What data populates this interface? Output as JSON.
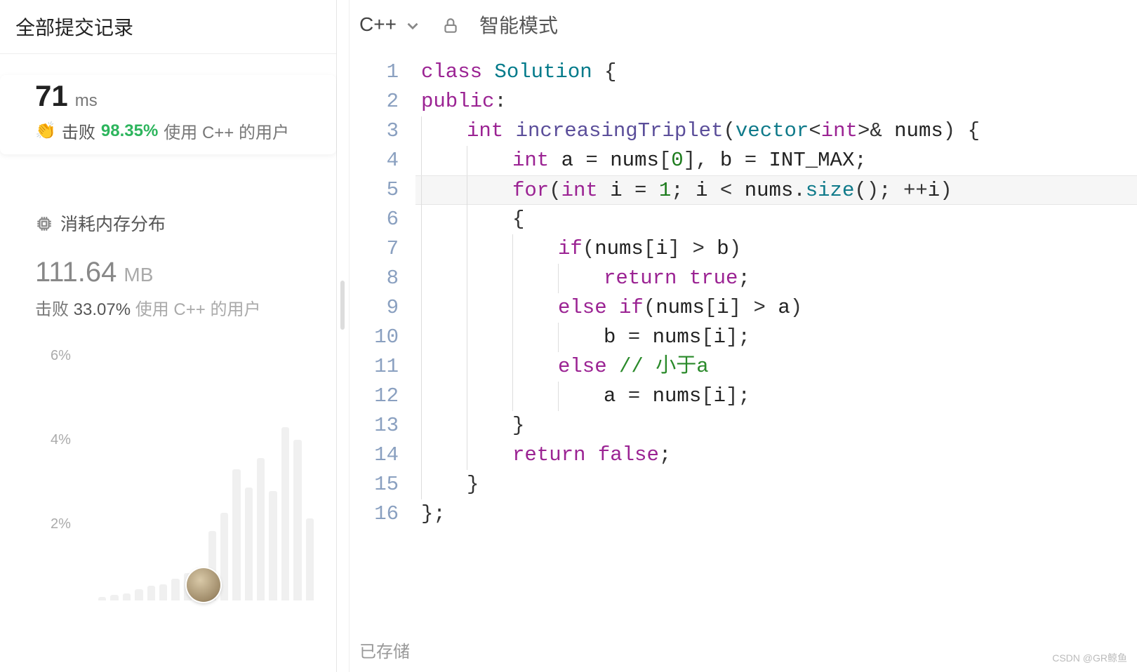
{
  "left": {
    "title": "全部提交记录",
    "runtime": {
      "value": "71",
      "unit": "ms",
      "beats_label": "击败",
      "beats_pct": "98.35%",
      "beats_suffix": "使用 C++ 的用户"
    },
    "memory": {
      "section_title": "消耗内存分布",
      "value": "111.64",
      "unit": "MB",
      "beats_label": "击败",
      "beats_pct": "33.07%",
      "beats_suffix": "使用 C++ 的用户"
    },
    "chart": {
      "y_ticks": [
        "6%",
        "4%",
        "2%"
      ],
      "bars_pct": [
        2,
        3,
        4,
        6,
        8,
        9,
        12,
        15,
        18,
        38,
        48,
        72,
        62,
        78,
        60,
        95,
        88,
        45
      ]
    }
  },
  "editor": {
    "language": "C++",
    "mode": "智能模式",
    "status": "已存储",
    "lines": [
      {
        "n": 1,
        "indent": 0,
        "segs": [
          [
            "kw",
            "class"
          ],
          [
            "pun",
            " "
          ],
          [
            "cls",
            "Solution"
          ],
          [
            "pun",
            " {"
          ]
        ]
      },
      {
        "n": 2,
        "indent": 0,
        "segs": [
          [
            "kw",
            "public"
          ],
          [
            "pun",
            ":"
          ]
        ]
      },
      {
        "n": 3,
        "indent": 1,
        "segs": [
          [
            "kw",
            "int"
          ],
          [
            "pun",
            " "
          ],
          [
            "fn",
            "increasingTriplet"
          ],
          [
            "pun",
            "("
          ],
          [
            "type",
            "vector"
          ],
          [
            "pun",
            "<"
          ],
          [
            "kw",
            "int"
          ],
          [
            "pun",
            ">& "
          ],
          [
            "ident",
            "nums"
          ],
          [
            "pun",
            ") {"
          ]
        ]
      },
      {
        "n": 4,
        "indent": 2,
        "segs": [
          [
            "kw",
            "int"
          ],
          [
            "pun",
            " "
          ],
          [
            "ident",
            "a"
          ],
          [
            "pun",
            " = "
          ],
          [
            "ident",
            "nums"
          ],
          [
            "pun",
            "["
          ],
          [
            "num",
            "0"
          ],
          [
            "pun",
            "], "
          ],
          [
            "ident",
            "b"
          ],
          [
            "pun",
            " = "
          ],
          [
            "ident",
            "INT_MAX"
          ],
          [
            "pun",
            ";"
          ]
        ]
      },
      {
        "n": 5,
        "indent": 2,
        "hl": true,
        "segs": [
          [
            "kw",
            "for"
          ],
          [
            "pun",
            "("
          ],
          [
            "kw",
            "int"
          ],
          [
            "pun",
            " "
          ],
          [
            "ident",
            "i"
          ],
          [
            "pun",
            " = "
          ],
          [
            "num",
            "1"
          ],
          [
            "pun",
            "; "
          ],
          [
            "ident",
            "i"
          ],
          [
            "pun",
            " < "
          ],
          [
            "ident",
            "nums"
          ],
          [
            "pun",
            "."
          ],
          [
            "type",
            "size"
          ],
          [
            "pun",
            "(); ++"
          ],
          [
            "ident",
            "i"
          ],
          [
            "pun",
            ")"
          ]
        ]
      },
      {
        "n": 6,
        "indent": 2,
        "segs": [
          [
            "pun",
            "{"
          ]
        ]
      },
      {
        "n": 7,
        "indent": 3,
        "segs": [
          [
            "kw",
            "if"
          ],
          [
            "pun",
            "("
          ],
          [
            "ident",
            "nums"
          ],
          [
            "pun",
            "["
          ],
          [
            "ident",
            "i"
          ],
          [
            "pun",
            "] > "
          ],
          [
            "ident",
            "b"
          ],
          [
            "pun",
            ")"
          ]
        ]
      },
      {
        "n": 8,
        "indent": 4,
        "segs": [
          [
            "kw",
            "return"
          ],
          [
            "pun",
            " "
          ],
          [
            "bool",
            "true"
          ],
          [
            "pun",
            ";"
          ]
        ]
      },
      {
        "n": 9,
        "indent": 3,
        "segs": [
          [
            "kw",
            "else"
          ],
          [
            "pun",
            " "
          ],
          [
            "kw",
            "if"
          ],
          [
            "pun",
            "("
          ],
          [
            "ident",
            "nums"
          ],
          [
            "pun",
            "["
          ],
          [
            "ident",
            "i"
          ],
          [
            "pun",
            "] > "
          ],
          [
            "ident",
            "a"
          ],
          [
            "pun",
            ")"
          ]
        ]
      },
      {
        "n": 10,
        "indent": 4,
        "segs": [
          [
            "ident",
            "b"
          ],
          [
            "pun",
            " = "
          ],
          [
            "ident",
            "nums"
          ],
          [
            "pun",
            "["
          ],
          [
            "ident",
            "i"
          ],
          [
            "pun",
            "];"
          ]
        ]
      },
      {
        "n": 11,
        "indent": 3,
        "segs": [
          [
            "kw",
            "else"
          ],
          [
            "pun",
            " "
          ],
          [
            "cmt",
            "// 小于a"
          ]
        ]
      },
      {
        "n": 12,
        "indent": 4,
        "segs": [
          [
            "ident",
            "a"
          ],
          [
            "pun",
            " = "
          ],
          [
            "ident",
            "nums"
          ],
          [
            "pun",
            "["
          ],
          [
            "ident",
            "i"
          ],
          [
            "pun",
            "];"
          ]
        ]
      },
      {
        "n": 13,
        "indent": 2,
        "segs": [
          [
            "pun",
            "}"
          ]
        ]
      },
      {
        "n": 14,
        "indent": 2,
        "segs": [
          [
            "kw",
            "return"
          ],
          [
            "pun",
            " "
          ],
          [
            "bool",
            "false"
          ],
          [
            "pun",
            ";"
          ]
        ]
      },
      {
        "n": 15,
        "indent": 1,
        "segs": [
          [
            "pun",
            "}"
          ]
        ]
      },
      {
        "n": 16,
        "indent": 0,
        "segs": [
          [
            "pun",
            "};"
          ]
        ]
      }
    ]
  },
  "watermark": "CSDN @GR鲸鱼",
  "chart_data": {
    "type": "bar",
    "title": "消耗内存分布",
    "ylabel": "percentage",
    "y_ticks": [
      2,
      4,
      6
    ],
    "values_pct_of_max": [
      2,
      3,
      4,
      6,
      8,
      9,
      12,
      15,
      18,
      38,
      48,
      72,
      62,
      78,
      60,
      95,
      88,
      45
    ],
    "marker_index": 5
  }
}
